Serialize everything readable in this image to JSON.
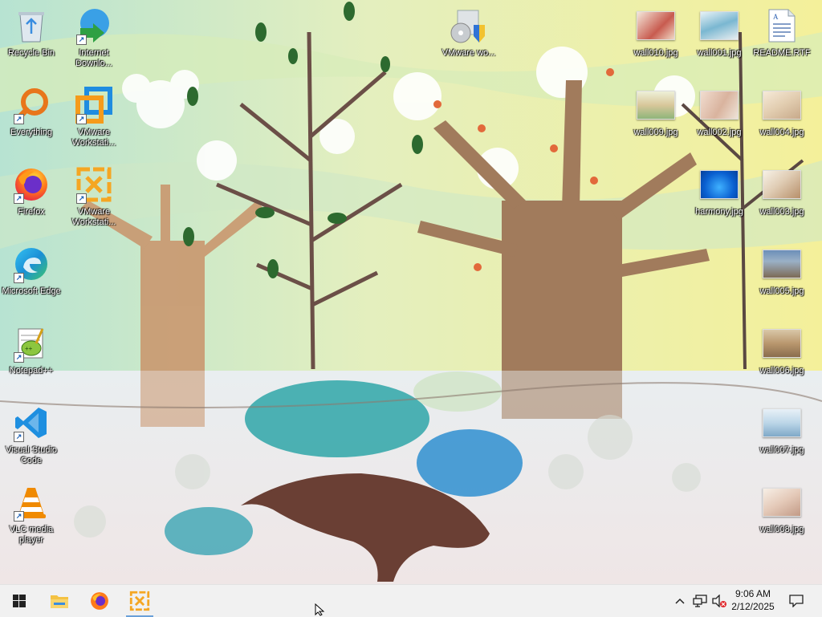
{
  "desktop": {
    "icons": [
      {
        "label": "Recycle Bin",
        "icon": "recycle-bin-icon"
      },
      {
        "label": "Internet Downlo...",
        "icon": "internet-download-manager-icon"
      },
      {
        "label": "VMware wo...",
        "icon": "vmware-installer-icon"
      },
      {
        "label": "wall010.jpg",
        "icon": "image-file-icon"
      },
      {
        "label": "wall001.jpg",
        "icon": "image-file-icon"
      },
      {
        "label": "README.RTF",
        "icon": "rtf-document-icon"
      },
      {
        "label": "Everything",
        "icon": "everything-search-icon"
      },
      {
        "label": "VMware Workstati...",
        "icon": "vmware-workstation-icon"
      },
      {
        "label": "wall009.jpg",
        "icon": "image-file-icon"
      },
      {
        "label": "wall002.jpg",
        "icon": "image-file-icon"
      },
      {
        "label": "wall004.jpg",
        "icon": "image-file-icon"
      },
      {
        "label": "Firefox",
        "icon": "firefox-icon"
      },
      {
        "label": "VMware Workstati...",
        "icon": "vmware-workstation-player-icon"
      },
      {
        "label": "harmony.jpg",
        "icon": "image-file-icon"
      },
      {
        "label": "wall003.jpg",
        "icon": "image-file-icon"
      },
      {
        "label": "Microsoft Edge",
        "icon": "edge-icon"
      },
      {
        "label": "wall005.jpg",
        "icon": "image-file-icon"
      },
      {
        "label": "Notepad++",
        "icon": "notepad-plus-plus-icon"
      },
      {
        "label": "wall006.jpg",
        "icon": "image-file-icon"
      },
      {
        "label": "Visual Studio Code",
        "icon": "vscode-icon"
      },
      {
        "label": "wall007.jpg",
        "icon": "image-file-icon"
      },
      {
        "label": "VLC media player",
        "icon": "vlc-icon"
      },
      {
        "label": "wall008.jpg",
        "icon": "image-file-icon"
      }
    ]
  },
  "taskbar": {
    "start": "start-windows-icon",
    "pinned": [
      {
        "name": "file-explorer-icon"
      },
      {
        "name": "firefox-icon"
      },
      {
        "name": "vmware-workstation-icon"
      }
    ],
    "tray": {
      "show_hidden": "chevron-up-icon",
      "network": "network-icon",
      "volume": "volume-muted-icon",
      "time": "9:06 AM",
      "date": "2/12/2025",
      "notifications": "action-center-icon"
    }
  },
  "colors": {
    "taskbar_bg": "#f1f1f1",
    "label_text": "#ffffff",
    "accent": "#0078d7"
  }
}
